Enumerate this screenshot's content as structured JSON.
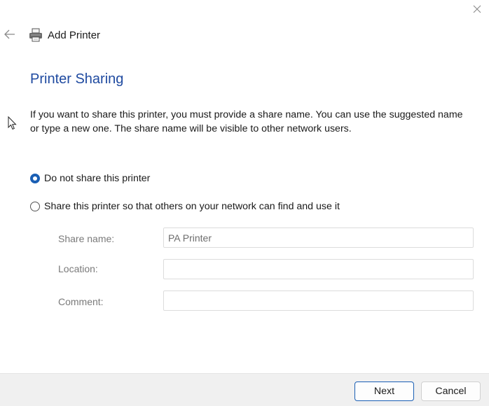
{
  "window": {
    "close_icon": "close-icon"
  },
  "header": {
    "back_icon": "back-arrow-icon",
    "printer_icon": "printer-icon",
    "title": "Add Printer"
  },
  "page": {
    "heading": "Printer Sharing",
    "description": "If you want to share this printer, you must provide a share name. You can use the suggested name or type a new one. The share name will be visible to other network users."
  },
  "options": {
    "do_not_share": {
      "label": "Do not share this printer",
      "selected": true
    },
    "share": {
      "label": "Share this printer so that others on your network can find and use it",
      "selected": false
    }
  },
  "fields": {
    "share_name": {
      "label": "Share name:",
      "value": "PA Printer"
    },
    "location": {
      "label": "Location:",
      "value": ""
    },
    "comment": {
      "label": "Comment:",
      "value": ""
    }
  },
  "footer": {
    "next_label": "Next",
    "cancel_label": "Cancel"
  },
  "colors": {
    "accent": "#1a5fb4",
    "heading": "#1f4aa0",
    "footer_bg": "#f0f0f0"
  }
}
